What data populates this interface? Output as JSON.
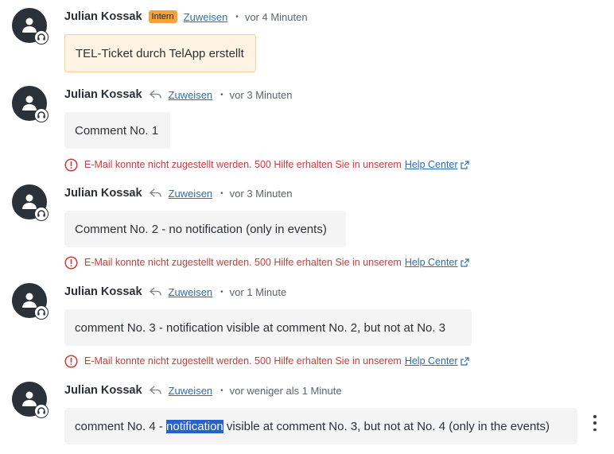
{
  "colors": {
    "accent_link": "#2f6db3",
    "error": "#d03a3a",
    "intern_badge": "#f6a13a",
    "avatar": "#2b3138"
  },
  "entries": [
    {
      "author": "Julian Kossak",
      "badge": "Intern",
      "assign_label": "Zuweisen",
      "time": "vor 4 Minuten",
      "body": "TEL-Ticket durch TelApp erstellt",
      "icons": {
        "avatar": "user-headset-icon"
      }
    },
    {
      "author": "Julian Kossak",
      "assign_label": "Zuweisen",
      "time": "vor 3 Minuten",
      "body": "Comment No. 1",
      "error": {
        "text": "E-Mail konnte nicht zugestellt werden. 500 Hilfe erhalten Sie in unserem",
        "link": "Help Center"
      },
      "icons": {
        "reply": "reply-arrow-icon",
        "error": "alert-circle-icon",
        "external": "external-link-icon"
      }
    },
    {
      "author": "Julian Kossak",
      "assign_label": "Zuweisen",
      "time": "vor 3 Minuten",
      "body": "Comment No. 2 - no notification (only in events)",
      "error": {
        "text": "E-Mail konnte nicht zugestellt werden. 500 Hilfe erhalten Sie in unserem",
        "link": "Help Center"
      }
    },
    {
      "author": "Julian Kossak",
      "assign_label": "Zuweisen",
      "time": "vor 1 Minute",
      "body": "comment No. 3 - notification visible at comment No. 2, but not at No. 3",
      "error": {
        "text": "E-Mail konnte nicht zugestellt werden. 500 Hilfe erhalten Sie in unserem",
        "link": "Help Center"
      }
    },
    {
      "author": "Julian Kossak",
      "assign_label": "Zuweisen",
      "time": "vor weniger als 1 Minute",
      "body_before": "comment No. 4 - ",
      "body_highlight": "notification",
      "body_after": " visible at comment No. 3, but not at No. 4 (only in the events)",
      "icons": {
        "more": "more-vertical-icon"
      }
    }
  ]
}
